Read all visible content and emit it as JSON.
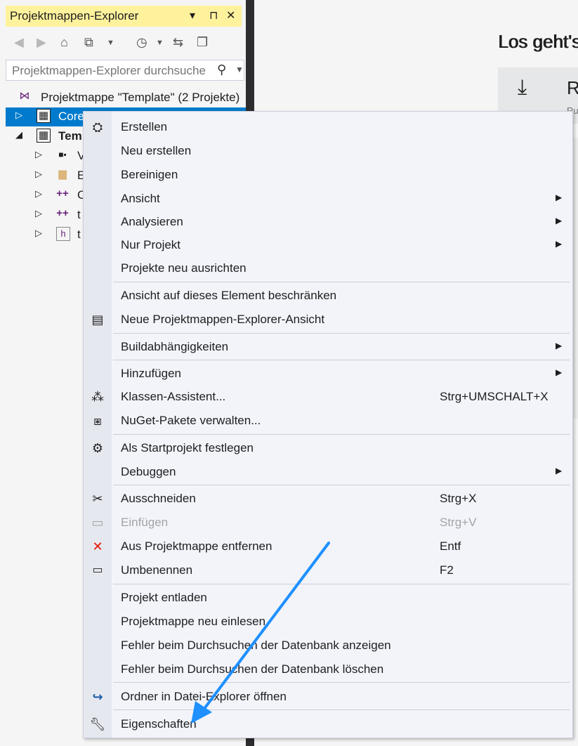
{
  "panel": {
    "title": "Projektmappen-Explorer",
    "title_buttons": [
      "▾",
      "⊓",
      "✕"
    ],
    "search_placeholder": "Projektmappen-Explorer durchsuche"
  },
  "tree": [
    {
      "label": "Projektmappe \"Template\" (2 Projekte)"
    },
    {
      "label": "Core"
    },
    {
      "label": "Tem"
    },
    {
      "label": "V"
    },
    {
      "label": "E"
    },
    {
      "label": "C"
    },
    {
      "label": "t"
    },
    {
      "label": "t"
    }
  ],
  "start_page": {
    "heading": "Los geht's",
    "card_title": "R",
    "card_sub": "Ru"
  },
  "menu": {
    "items": [
      {
        "label": "Erstellen",
        "icon": "build-icon"
      },
      {
        "label": "Neu erstellen"
      },
      {
        "label": "Bereinigen"
      },
      {
        "label": "Ansicht",
        "submenu": true
      },
      {
        "label": "Analysieren",
        "submenu": true
      },
      {
        "label": "Nur Projekt",
        "submenu": true
      },
      {
        "label": "Projekte neu ausrichten"
      },
      {
        "label": "Ansicht auf dieses Element beschränken"
      },
      {
        "label": "Neue Projektmappen-Explorer-Ansicht",
        "icon": "new-view-icon"
      },
      {
        "label": "Buildabhängigkeiten",
        "submenu": true
      },
      {
        "label": "Hinzufügen",
        "submenu": true
      },
      {
        "label": "Klassen-Assistent...",
        "shortcut": "Strg+UMSCHALT+X",
        "icon": "class-wizard-icon"
      },
      {
        "label": "NuGet-Pakete verwalten...",
        "icon": "nuget-icon"
      },
      {
        "label": "Als Startprojekt festlegen",
        "icon": "gear-icon"
      },
      {
        "label": "Debuggen",
        "submenu": true
      },
      {
        "label": "Ausschneiden",
        "shortcut": "Strg+X",
        "icon": "scissors-icon"
      },
      {
        "label": "Einfügen",
        "shortcut": "Strg+V",
        "icon": "paste-icon",
        "disabled": true
      },
      {
        "label": "Aus Projektmappe entfernen",
        "shortcut": "Entf",
        "icon": "remove-icon"
      },
      {
        "label": "Umbenennen",
        "shortcut": "F2",
        "icon": "rename-icon"
      },
      {
        "label": "Projekt entladen"
      },
      {
        "label": "Projektmappe neu einlesen"
      },
      {
        "label": "Fehler beim Durchsuchen der Datenbank anzeigen"
      },
      {
        "label": "Fehler beim Durchsuchen der Datenbank löschen"
      },
      {
        "label": "Ordner in Datei-Explorer öffnen",
        "icon": "open-folder-icon"
      },
      {
        "label": "Eigenschaften",
        "icon": "wrench-icon"
      }
    ]
  },
  "colors": {
    "title_bar": "#fff29d",
    "selection": "#007acc",
    "annotation_arrow": "#1e90ff",
    "remove_icon": "#e51400"
  }
}
